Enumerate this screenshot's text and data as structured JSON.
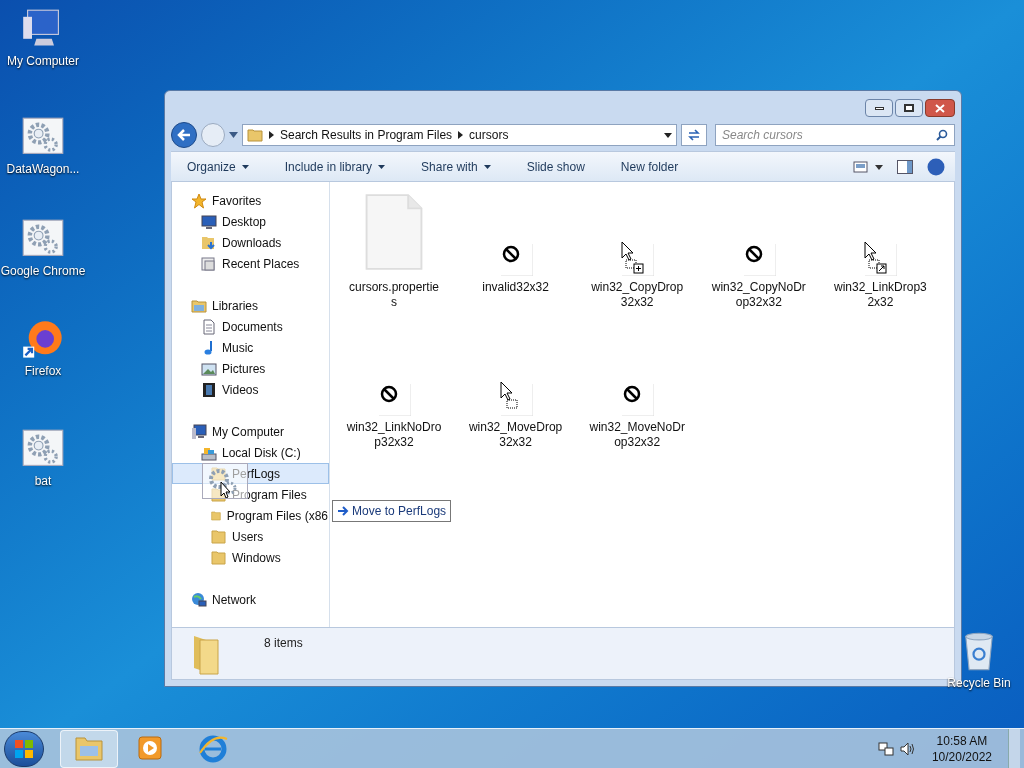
{
  "desktop_icons": [
    {
      "label": "My Computer",
      "kind": "computer"
    },
    {
      "label": "DataWagon...",
      "kind": "gear"
    },
    {
      "label": "Google Chrome",
      "kind": "gear"
    },
    {
      "label": "Firefox",
      "kind": "firefox"
    },
    {
      "label": "bat",
      "kind": "gear"
    },
    {
      "label": "Recycle Bin",
      "kind": "bin"
    }
  ],
  "window": {
    "breadcrumb": [
      "Search Results in Program Files",
      "cursors"
    ],
    "search": {
      "placeholder": "Search cursors"
    },
    "toolbar": [
      {
        "label": "Organize",
        "dropdown": true
      },
      {
        "label": "Include in library",
        "dropdown": true
      },
      {
        "label": "Share with",
        "dropdown": true
      },
      {
        "label": "Slide show",
        "dropdown": false
      },
      {
        "label": "New folder",
        "dropdown": false
      }
    ],
    "nav": [
      {
        "label": "Favorites",
        "kind": "star",
        "selected": false,
        "children": [
          {
            "label": "Desktop",
            "kind": "desktop",
            "selected": false
          },
          {
            "label": "Downloads",
            "kind": "download",
            "selected": false
          },
          {
            "label": "Recent Places",
            "kind": "recent",
            "selected": false
          }
        ]
      },
      {
        "label": "Libraries",
        "kind": "library",
        "selected": false,
        "children": [
          {
            "label": "Documents",
            "kind": "document",
            "selected": false
          },
          {
            "label": "Music",
            "kind": "music",
            "selected": false
          },
          {
            "label": "Pictures",
            "kind": "picture",
            "selected": false
          },
          {
            "label": "Videos",
            "kind": "video",
            "selected": false
          }
        ]
      },
      {
        "label": "My Computer",
        "kind": "computer",
        "selected": false,
        "children": [
          {
            "label": "Local Disk (C:)",
            "kind": "disk",
            "selected": false,
            "children": [
              {
                "label": "PerfLogs",
                "kind": "folder",
                "selected": true
              },
              {
                "label": "Program Files",
                "kind": "folder",
                "selected": false
              },
              {
                "label": "Program Files (x86",
                "kind": "folder",
                "selected": false
              },
              {
                "label": "Users",
                "kind": "folder",
                "selected": false
              },
              {
                "label": "Windows",
                "kind": "folder",
                "selected": false
              }
            ]
          }
        ]
      },
      {
        "label": "Network",
        "kind": "network",
        "selected": false
      }
    ],
    "files": [
      {
        "name": "cursors.properties",
        "kind": "document"
      },
      {
        "name": "invalid32x32",
        "kind": "nodrop"
      },
      {
        "name": "win32_CopyDrop32x32",
        "kind": "copy"
      },
      {
        "name": "win32_CopyNoDrop32x32",
        "kind": "nodrop"
      },
      {
        "name": "win32_LinkDrop32x32",
        "kind": "link"
      },
      {
        "name": "win32_LinkNoDrop32x32",
        "kind": "nodrop"
      },
      {
        "name": "win32_MoveDrop32x32",
        "kind": "move"
      },
      {
        "name": "win32_MoveNoDrop32x32",
        "kind": "nodrop"
      }
    ],
    "status": "8 items"
  },
  "drag": {
    "tooltip": "Move to PerfLogs"
  },
  "taskbar": {
    "apps": [
      {
        "kind": "explorer",
        "selected": true
      },
      {
        "kind": "media",
        "selected": false
      },
      {
        "kind": "browser",
        "selected": false
      }
    ],
    "time": "10:58 AM",
    "date": "10/20/2022"
  }
}
